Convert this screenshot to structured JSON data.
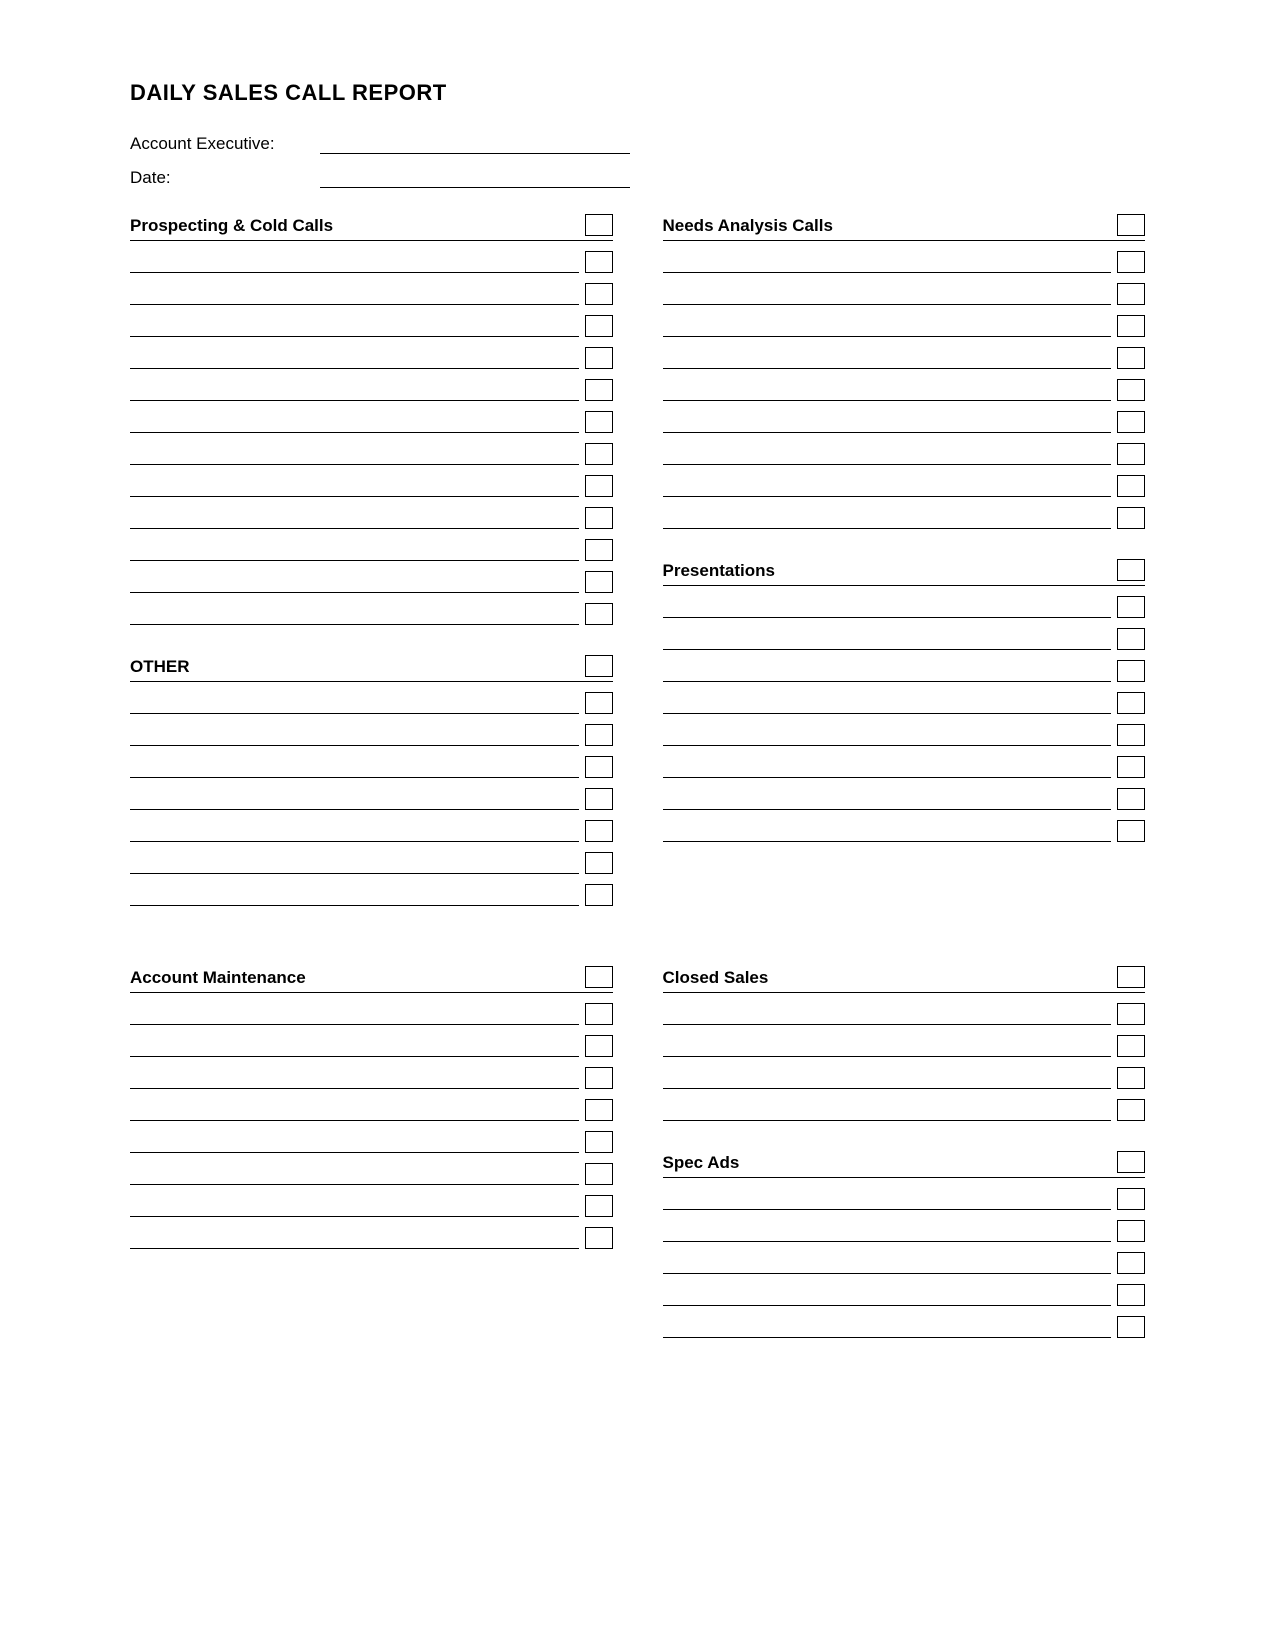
{
  "page": {
    "title": "DAILY SALES CALL REPORT",
    "fields": {
      "account_executive_label": "Account Executive:",
      "date_label": "Date:"
    },
    "sections": {
      "prospecting": {
        "title": "Prospecting & Cold Calls",
        "rows": 12
      },
      "other": {
        "title": "OTHER",
        "rows": 7
      },
      "needs_analysis": {
        "title": "Needs Analysis Calls",
        "rows": 9
      },
      "presentations": {
        "title": "Presentations",
        "rows": 8
      },
      "account_maintenance": {
        "title": "Account Maintenance",
        "rows": 8
      },
      "closed_sales": {
        "title": "Closed Sales",
        "rows": 4
      },
      "spec_ads": {
        "title": "Spec Ads",
        "rows": 5
      }
    }
  }
}
